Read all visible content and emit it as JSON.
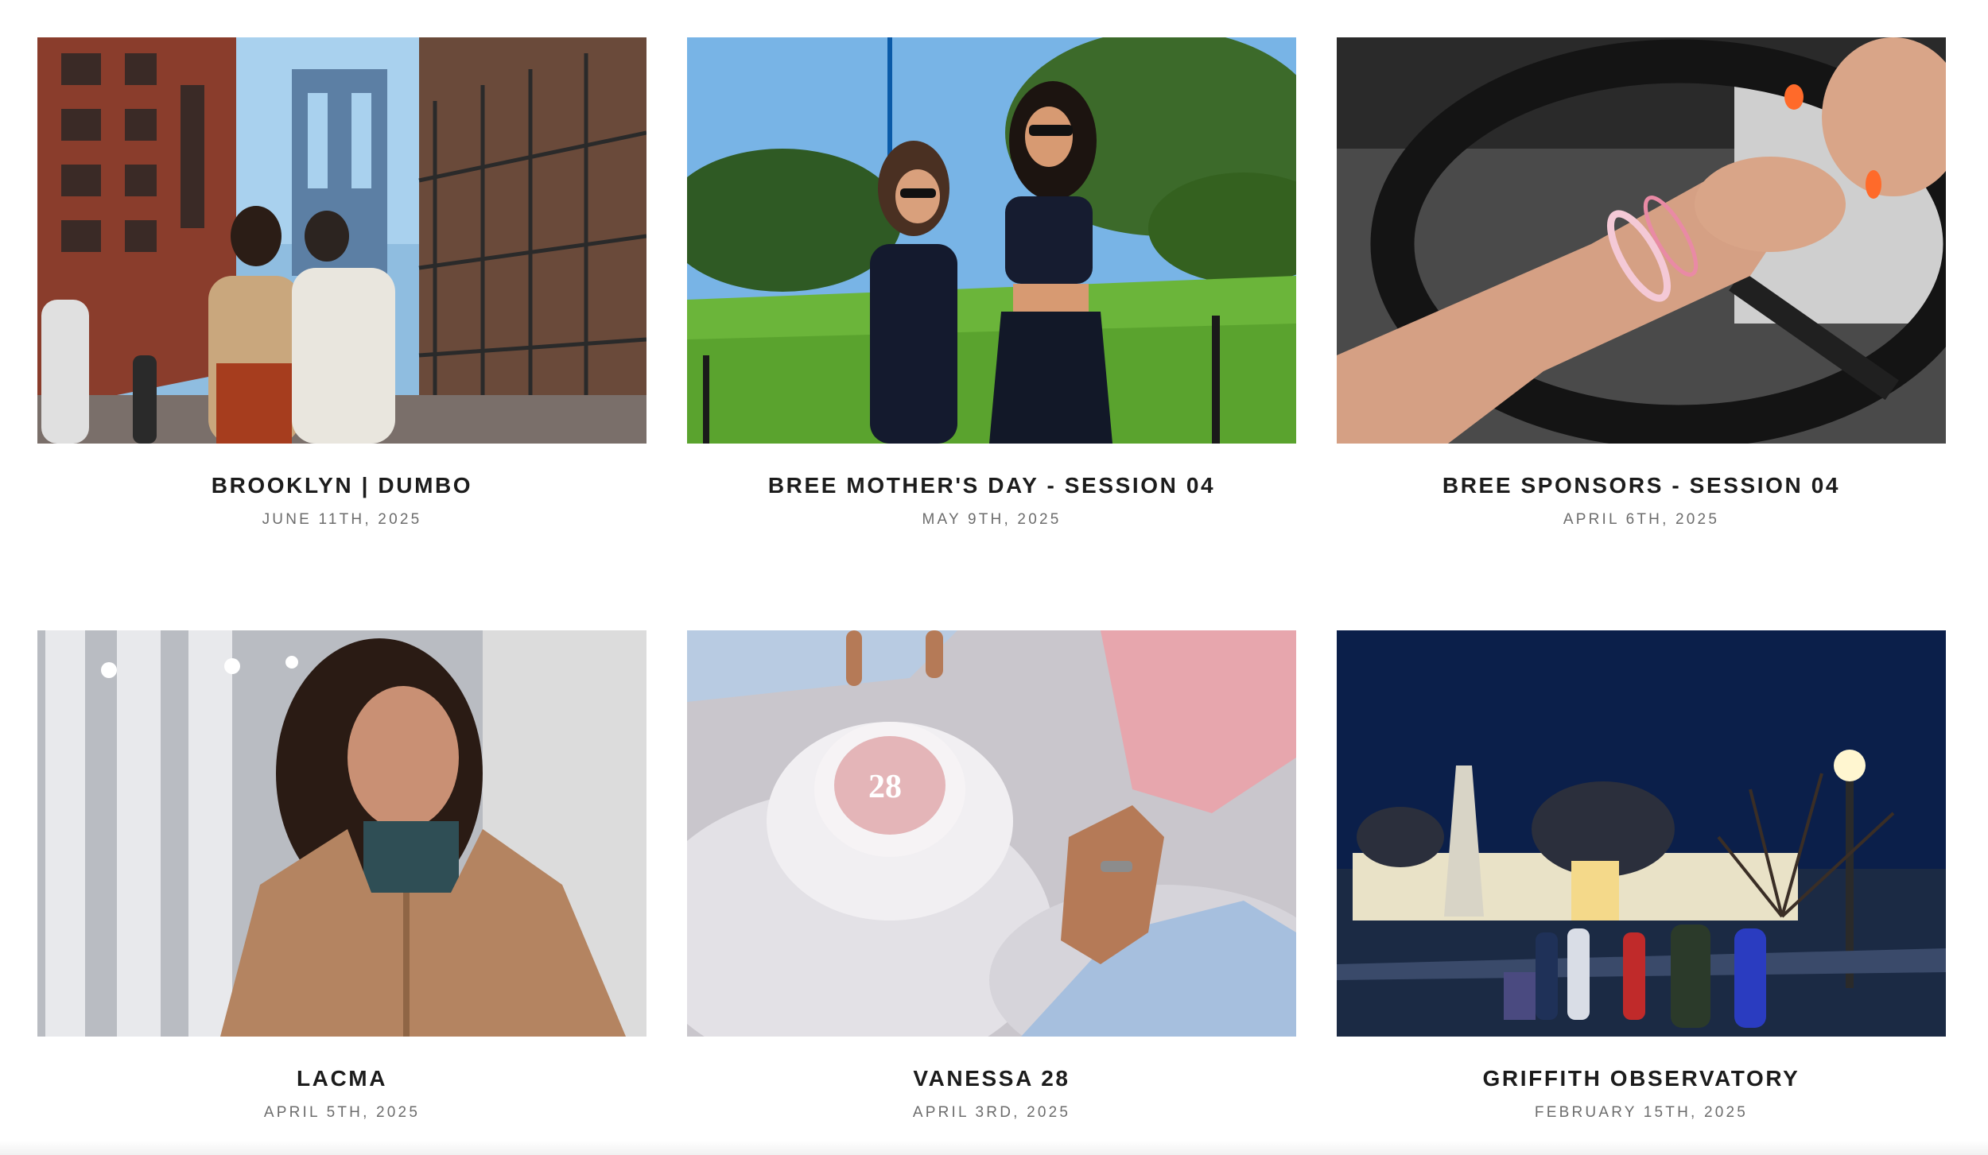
{
  "galleries": [
    {
      "title": "BROOKLYN | DUMBO",
      "date": "JUNE 11TH, 2025",
      "image": "brooklyn-dumbo-photo"
    },
    {
      "title": "BREE MOTHER'S DAY - SESSION 04",
      "date": "MAY 9TH, 2025",
      "image": "mothers-day-photo"
    },
    {
      "title": "BREE SPONSORS - SESSION 04",
      "date": "APRIL 6TH, 2025",
      "image": "sponsors-steering-wheel-photo"
    },
    {
      "title": "LACMA",
      "date": "APRIL 5TH, 2025",
      "image": "lacma-portrait-photo"
    },
    {
      "title": "VANESSA 28",
      "date": "APRIL 3RD, 2025",
      "image": "birthday-cake-photo"
    },
    {
      "title": "GRIFFITH OBSERVATORY",
      "date": "FEBRUARY 15TH, 2025",
      "image": "griffith-observatory-photo"
    }
  ]
}
